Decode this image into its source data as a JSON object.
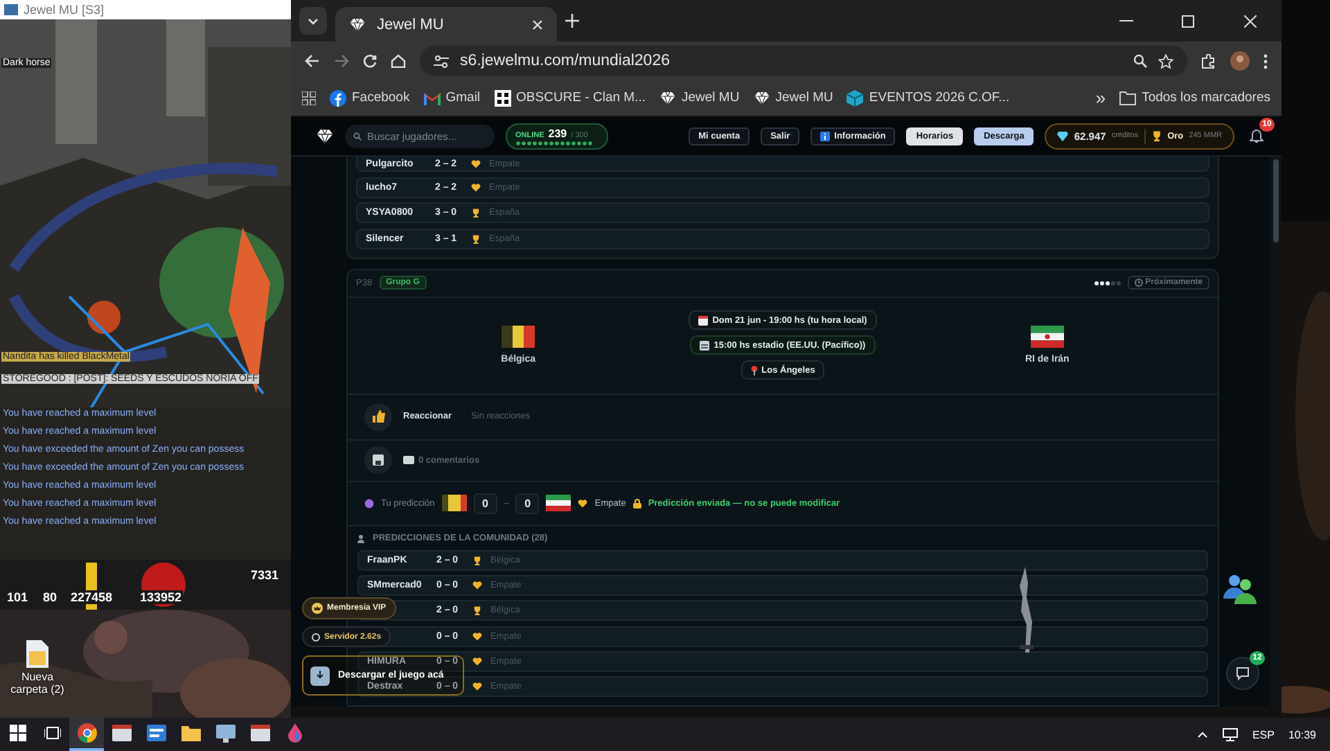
{
  "game_window": {
    "title": "Jewel MU [S3]",
    "target_label": "Dark horse",
    "kill_notice": "Nandita has killed BlackMetal",
    "post": "STOREGOOD : [POST]: SEEDS Y ESCUDOS NORIA OFF",
    "messages": [
      "You have reached a maximum level",
      "You have reached a maximum level",
      "You have exceeded the amount of Zen you can possess",
      "You have exceeded the amount of Zen you can possess",
      "You have reached a maximum level",
      "You have reached a maximum level",
      "You have reached a maximum level"
    ],
    "hud": [
      "101",
      "80",
      "227458",
      "133952",
      "7331"
    ]
  },
  "desktop": {
    "icons": [
      {
        "label": "Nueva carpeta (2)"
      }
    ]
  },
  "browser": {
    "tabs": [
      {
        "title": "Jewel MU",
        "selected": true
      }
    ],
    "url": "s6.jewelmu.com/mundial2026",
    "bookmarks": [
      {
        "kind": "facebook",
        "label": "Facebook"
      },
      {
        "kind": "gmail",
        "label": "Gmail"
      },
      {
        "kind": "grid",
        "label": "OBSCURE - Clan M..."
      },
      {
        "kind": "diamond",
        "label": "Jewel MU"
      },
      {
        "kind": "diamond",
        "label": "Jewel MU"
      },
      {
        "kind": "cube",
        "label": "EVENTOS 2026 C.OF..."
      }
    ],
    "more": "»",
    "all_bookmarks": "Todos los marcadores"
  },
  "site": {
    "search": {
      "placeholder": "Buscar jugadores..."
    },
    "online": {
      "label": "ONLINE",
      "count": "239",
      "max": "/ 300"
    },
    "nav": [
      {
        "label": "Mi cuenta",
        "kind": "plain"
      },
      {
        "label": "Salir",
        "kind": "plain"
      },
      {
        "label": "Información",
        "kind": "info"
      },
      {
        "label": "Horarios",
        "kind": "light"
      },
      {
        "label": "Descarga",
        "kind": "blue"
      }
    ],
    "credits": "62.947",
    "credits_label": "créditos",
    "gold": "Oro",
    "mmr": "245 MMR",
    "notifications": "10"
  },
  "previous_predictions": [
    {
      "player": "Pulgarcito",
      "score": "2 – 2",
      "kind": "draw",
      "pick": "Empate"
    },
    {
      "player": "lucho7",
      "score": "2 – 2",
      "kind": "draw",
      "pick": "Empate"
    },
    {
      "player": "YSYA0800",
      "score": "3 – 0",
      "kind": "win",
      "pick": "España"
    },
    {
      "player": "Silencer",
      "score": "3 – 1",
      "kind": "win",
      "pick": "España"
    }
  ],
  "match": {
    "code": "P38",
    "group": "Grupo G",
    "stars": 3,
    "status": "Próximamente",
    "home": {
      "name": "Bélgica"
    },
    "away": {
      "name": "RI de Irán"
    },
    "date": "Dom 21 jun - 19:00 hs (tu hora local)",
    "stadium_time": "15:00 hs estadio (EE.UU. (Pacífico))",
    "city": "Los Ángeles",
    "react_label": "Reaccionar",
    "reactions": "Sin reacciones",
    "comments": "0 comentarios",
    "prediction": {
      "label": "Tu predicción",
      "home_goals": "0",
      "separator": "–",
      "away_goals": "0",
      "pick": "Empate",
      "locked": "Predicción enviada — no se puede modificar"
    },
    "community_title": "PREDICCIONES DE LA COMUNIDAD (28)",
    "community": [
      {
        "player": "FraanPK",
        "score": "2 – 0",
        "kind": "win",
        "pick": "Bélgica"
      },
      {
        "player": "SMmercad0",
        "score": "0 – 0",
        "kind": "draw",
        "pick": "Empate"
      },
      {
        "score": "2 – 0",
        "kind": "win",
        "pick": "Bélgica"
      },
      {
        "score": "0 – 0",
        "kind": "draw",
        "pick": "Empate"
      },
      {
        "player": "HIMURA",
        "score": "0 – 0",
        "kind": "draw",
        "pick": "Empate"
      },
      {
        "player": "Destrax",
        "score": "0 – 0",
        "kind": "draw",
        "pick": "Empate"
      }
    ]
  },
  "floating": {
    "vip": "Membresía VIP",
    "server": "Servidor 2.62s",
    "download": "Descargar el juego acá",
    "chat_badge": "12"
  },
  "taskbar": {
    "apps": [
      {
        "kind": "chrome",
        "selected": true
      },
      {
        "kind": "window",
        "selected": false
      },
      {
        "kind": "blue",
        "selected": false
      },
      {
        "kind": "folder",
        "selected": false
      },
      {
        "kind": "monitor",
        "selected": false
      },
      {
        "kind": "window",
        "selected": false
      },
      {
        "kind": "drop",
        "selected": false
      }
    ],
    "lang": "ESP",
    "time": "10:39"
  }
}
